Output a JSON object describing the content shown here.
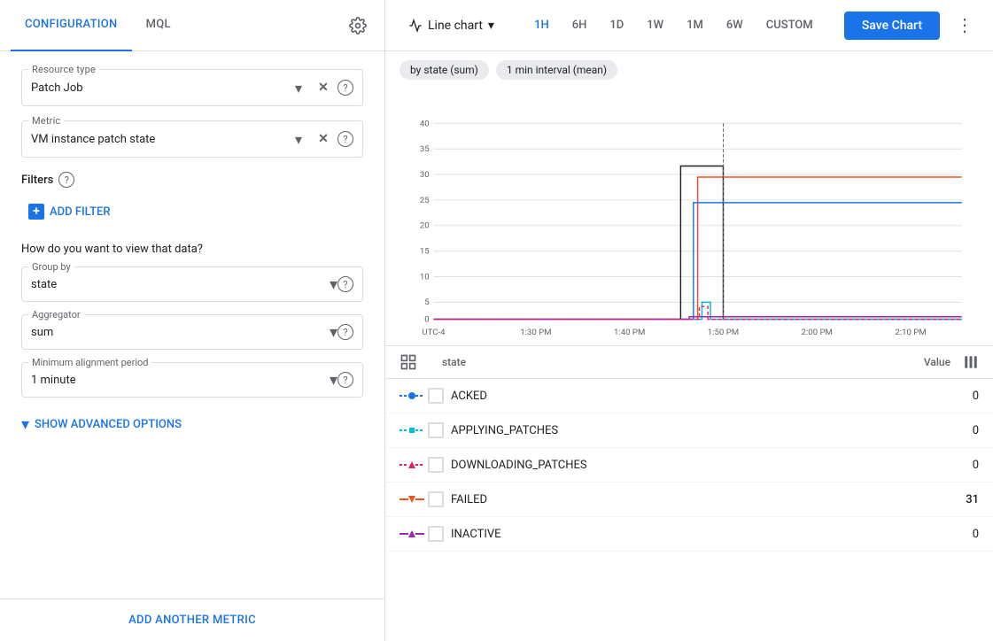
{
  "leftPanel": {
    "tabs": [
      {
        "id": "configuration",
        "label": "CONFIGURATION",
        "active": true
      },
      {
        "id": "mql",
        "label": "MQL",
        "active": false
      }
    ],
    "resourceType": {
      "label": "Resource type",
      "value": "Patch Job"
    },
    "metric": {
      "label": "Metric",
      "value": "VM instance patch state"
    },
    "filters": {
      "label": "Filters",
      "addButton": "ADD FILTER"
    },
    "dataViewTitle": "How do you want to view that data?",
    "groupBy": {
      "label": "Group by",
      "value": "state"
    },
    "aggregator": {
      "label": "Aggregator",
      "value": "sum"
    },
    "minAlignmentPeriod": {
      "label": "Minimum alignment period",
      "value": "1 minute"
    },
    "advancedOptions": "SHOW ADVANCED OPTIONS",
    "addMetricFooter": "ADD ANOTHER METRIC"
  },
  "rightPanel": {
    "chartType": "Line chart",
    "timePeriods": [
      "1H",
      "6H",
      "1D",
      "1W",
      "1M",
      "6W",
      "CUSTOM"
    ],
    "activeTimePeriod": "1H",
    "saveButton": "Save Chart",
    "filters": [
      "by state (sum)",
      "1 min interval (mean)"
    ],
    "yAxisLabels": [
      0,
      5,
      10,
      15,
      20,
      25,
      30,
      35,
      40
    ],
    "xAxisLabels": [
      "UTC-4",
      "1:30 PM",
      "1:40 PM",
      "1:50 PM",
      "2:00 PM",
      "2:10 PM"
    ],
    "legendHeader": {
      "stateLabel": "state",
      "valueLabel": "Value"
    },
    "legendRows": [
      {
        "name": "ACKED",
        "value": "0",
        "color": "#1a73e8",
        "lineStyle": "dashed"
      },
      {
        "name": "APPLYING_PATCHES",
        "value": "0",
        "color": "#00bcd4",
        "lineStyle": "dashed"
      },
      {
        "name": "DOWNLOADING_PATCHES",
        "value": "0",
        "color": "#e91e63",
        "lineStyle": "dashed"
      },
      {
        "name": "FAILED",
        "value": "31",
        "color": "#f4511e",
        "lineStyle": "solid"
      },
      {
        "name": "INACTIVE",
        "value": "0",
        "color": "#9c27b0",
        "lineStyle": "solid"
      }
    ]
  }
}
